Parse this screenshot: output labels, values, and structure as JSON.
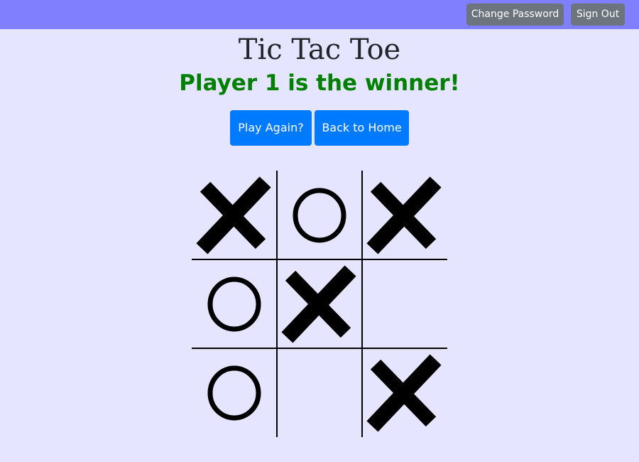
{
  "header": {
    "change_password_label": "Change Password",
    "sign_out_label": "Sign Out"
  },
  "main": {
    "title": "Tic Tac Toe",
    "status_message": "Player 1 is the winner!",
    "play_again_label": "Play Again?",
    "back_home_label": "Back to Home"
  },
  "board": {
    "cells": [
      "X",
      "O",
      "X",
      "O",
      "X",
      "",
      "O",
      "",
      "X"
    ]
  },
  "colors": {
    "topbar": "#8080ff",
    "background": "#e5e5ff",
    "primary_button": "#007bff",
    "secondary_button": "#6c757d",
    "winner_text": "#008000"
  },
  "icons": {
    "x_mark": "x-mark-icon",
    "o_mark": "o-mark-icon"
  }
}
